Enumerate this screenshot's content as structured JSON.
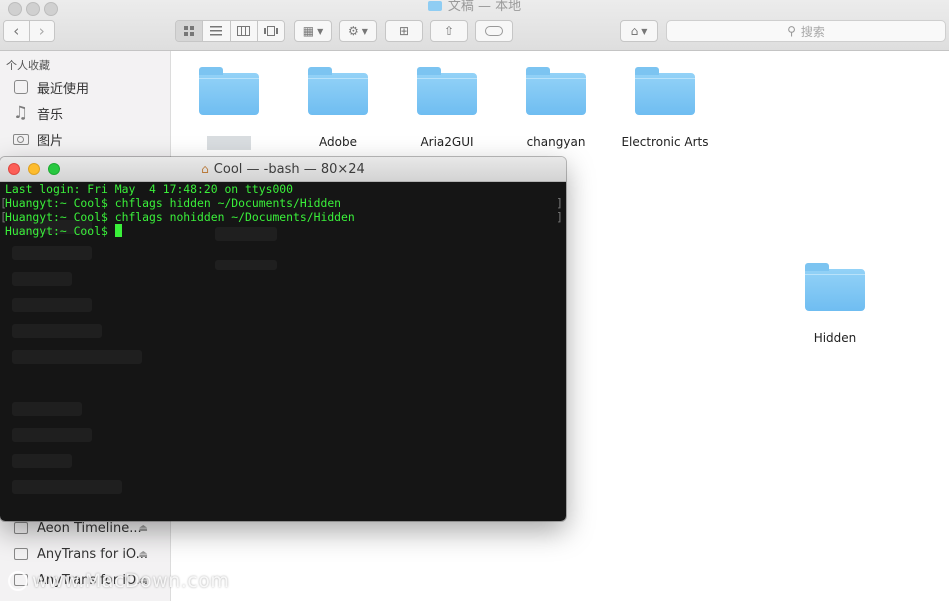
{
  "finder": {
    "title": "文稿 — 本地",
    "search_placeholder": "搜索",
    "sidebar": {
      "section_label": "个人收藏",
      "items": [
        {
          "label": "最近使用",
          "icon": "recents-icon"
        },
        {
          "label": "音乐",
          "icon": "music-icon"
        },
        {
          "label": "图片",
          "icon": "pictures-icon"
        }
      ],
      "devices": [
        {
          "label": "Aeon Timeline...",
          "icon": "disk-icon"
        },
        {
          "label": "AnyTrans for iO...",
          "icon": "disk-icon"
        },
        {
          "label": "AnyTrans for iO...",
          "icon": "disk-icon"
        }
      ]
    },
    "folders": [
      {
        "label": ""
      },
      {
        "label": "Adobe"
      },
      {
        "label": "Aria2GUI"
      },
      {
        "label": "changyan"
      },
      {
        "label": "Electronic Arts"
      },
      {
        "label": "Hidden"
      }
    ]
  },
  "terminal": {
    "title": "Cool — -bash — 80×24",
    "lines": [
      "Last login: Fri May  4 17:48:20 on ttys000",
      "Huangyt:~ Cool$ chflags hidden ~/Documents/Hidden",
      "Huangyt:~ Cool$ chflags nohidden ~/Documents/Hidden",
      "Huangyt:~ Cool$ "
    ]
  },
  "watermark": "www.MacDown.com"
}
